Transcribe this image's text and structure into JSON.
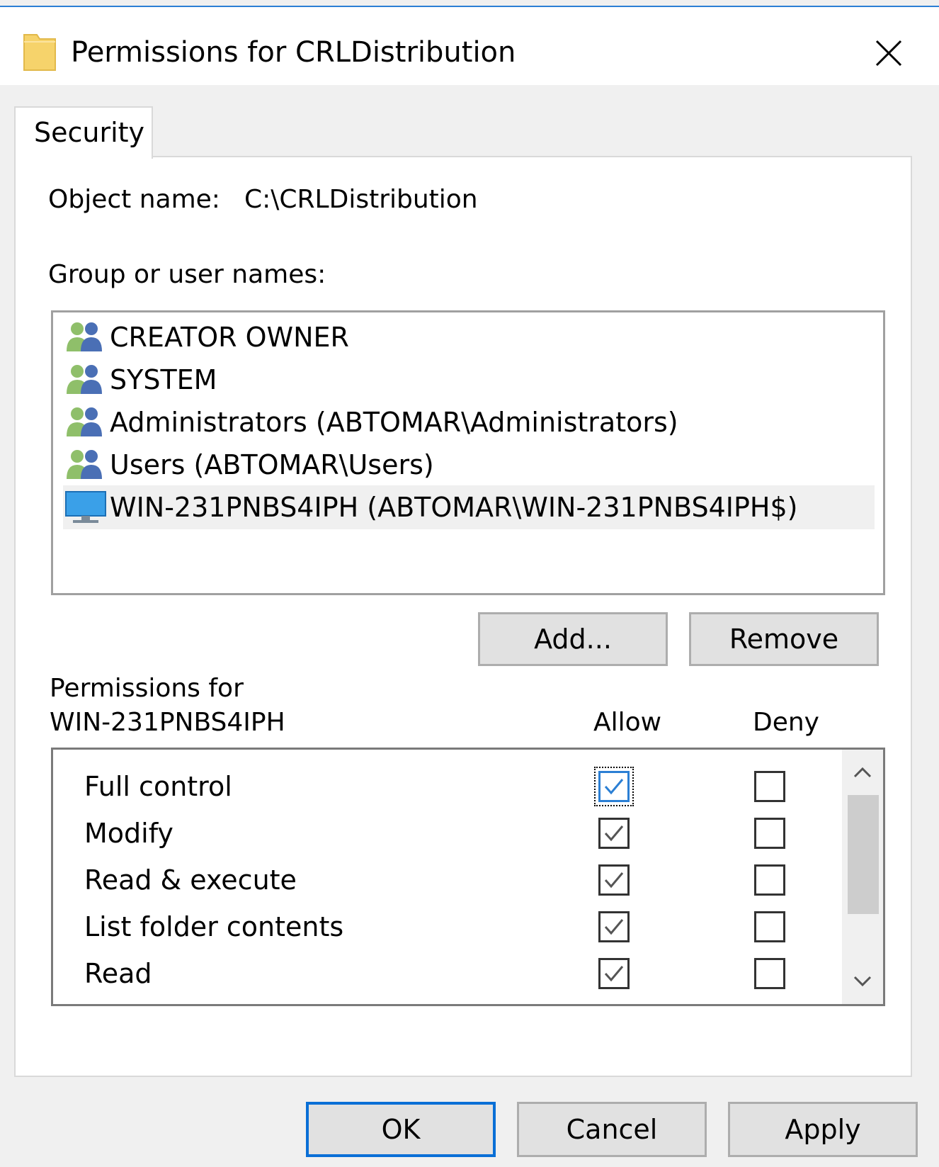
{
  "window": {
    "title": "Permissions for CRLDistribution",
    "close_icon": "close-icon"
  },
  "tabs": [
    {
      "label": "Security",
      "selected": true
    }
  ],
  "object": {
    "label": "Object name:",
    "value": "C:\\CRLDistribution"
  },
  "groups": {
    "label": "Group or user names:",
    "items": [
      {
        "name": "CREATOR OWNER",
        "icon": "user-group-icon",
        "selected": false
      },
      {
        "name": "SYSTEM",
        "icon": "user-group-icon",
        "selected": false
      },
      {
        "name": "Administrators (ABTOMAR\\Administrators)",
        "icon": "user-group-icon",
        "selected": false
      },
      {
        "name": "Users (ABTOMAR\\Users)",
        "icon": "user-group-icon",
        "selected": false
      },
      {
        "name": "WIN-231PNBS4IPH (ABTOMAR\\WIN-231PNBS4IPH$)",
        "icon": "computer-icon",
        "selected": true
      }
    ]
  },
  "buttons": {
    "add": "Add...",
    "remove": "Remove",
    "ok": "OK",
    "cancel": "Cancel",
    "apply": "Apply"
  },
  "permissions": {
    "label_line1": "Permissions for",
    "label_line2": "WIN-231PNBS4IPH",
    "allow_header": "Allow",
    "deny_header": "Deny",
    "rows": [
      {
        "name": "Full control",
        "allow": true,
        "deny": false
      },
      {
        "name": "Modify",
        "allow": true,
        "deny": false
      },
      {
        "name": "Read & execute",
        "allow": true,
        "deny": false
      },
      {
        "name": "List folder contents",
        "allow": true,
        "deny": false
      },
      {
        "name": "Read",
        "allow": true,
        "deny": false
      }
    ]
  },
  "colors": {
    "accent": "#2b7fd4",
    "folder": "#f6d36b",
    "check": "#555555",
    "focused_check": "#2b7fd4"
  }
}
